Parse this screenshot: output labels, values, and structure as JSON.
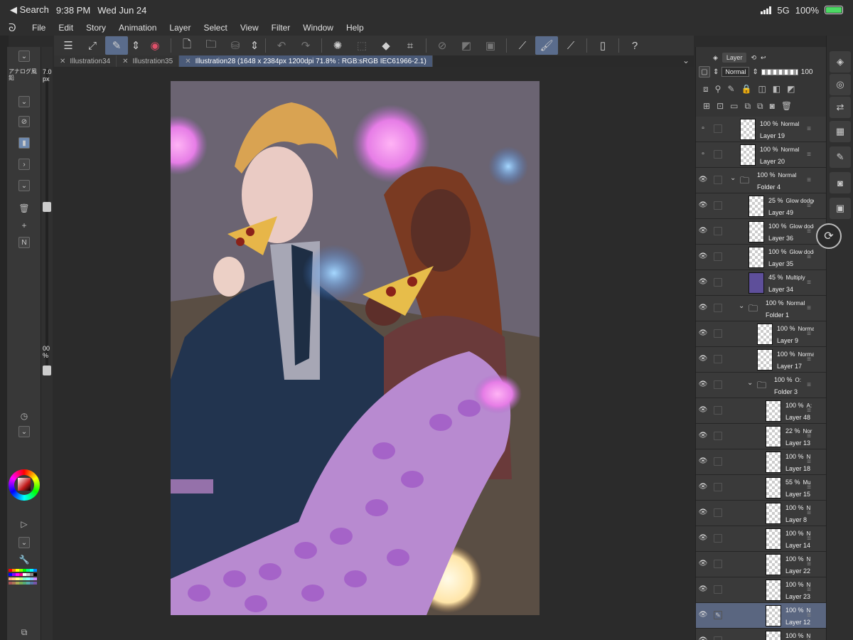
{
  "status_bar": {
    "back_label": "◀ Search",
    "time": "9:38 PM",
    "date": "Wed Jun 24",
    "network": "5G",
    "battery": "100%"
  },
  "menu": {
    "items": [
      "File",
      "Edit",
      "Story",
      "Animation",
      "Layer",
      "Select",
      "View",
      "Filter",
      "Window",
      "Help"
    ]
  },
  "tabs": [
    {
      "label": "Illustration34"
    },
    {
      "label": "Illustration35"
    },
    {
      "label": "Illustration28 (1648 x 2384px 1200dpi 71.8% : RGB:sRGB IEC61966-2.1)"
    }
  ],
  "left_panel": {
    "brush_name": "アナログ風鉛",
    "size_value": "7.0",
    "size_unit": "px",
    "opacity_value": "00",
    "opacity_unit": "%"
  },
  "layer_panel": {
    "tab_label": "Layer",
    "blend_mode": "Normal",
    "opacity": "100",
    "layers": [
      {
        "opacity": "100 %",
        "mode": "Normal",
        "name": "Layer 19",
        "visible": false,
        "indent": 0
      },
      {
        "opacity": "100 %",
        "mode": "Normal",
        "name": "Layer 20",
        "visible": false,
        "indent": 0
      },
      {
        "opacity": "100 %",
        "mode": "Normal",
        "name": "Folder 4",
        "visible": true,
        "indent": 0,
        "folder": true
      },
      {
        "opacity": "25 %",
        "mode": "Glow dodge",
        "name": "Layer 49",
        "visible": true,
        "indent": 1
      },
      {
        "opacity": "100 %",
        "mode": "Glow dodg",
        "name": "Layer 36",
        "visible": true,
        "indent": 1
      },
      {
        "opacity": "100 %",
        "mode": "Glow dodg",
        "name": "Layer 35",
        "visible": true,
        "indent": 1
      },
      {
        "opacity": "45 %",
        "mode": "Multiply",
        "name": "Layer 34",
        "visible": true,
        "indent": 1,
        "thumb": "purple"
      },
      {
        "opacity": "100 %",
        "mode": "Normal",
        "name": "Folder 1",
        "visible": true,
        "indent": 1,
        "folder": true
      },
      {
        "opacity": "100 %",
        "mode": "Norma",
        "name": "Layer 9",
        "visible": true,
        "indent": 2
      },
      {
        "opacity": "100 %",
        "mode": "Norma",
        "name": "Layer 17",
        "visible": true,
        "indent": 2
      },
      {
        "opacity": "100 %",
        "mode": "O:",
        "name": "Folder 3",
        "visible": true,
        "indent": 2,
        "folder": true
      },
      {
        "opacity": "100 %",
        "mode": "A:",
        "name": "Layer 48",
        "visible": true,
        "indent": 3
      },
      {
        "opacity": "22 %",
        "mode": "Nor",
        "name": "Layer 13",
        "visible": true,
        "indent": 3
      },
      {
        "opacity": "100 %",
        "mode": "N",
        "name": "Layer 18",
        "visible": true,
        "indent": 3
      },
      {
        "opacity": "55 %",
        "mode": "Mu",
        "name": "Layer 15",
        "visible": true,
        "indent": 3
      },
      {
        "opacity": "100 %",
        "mode": "N",
        "name": "Layer 8",
        "visible": true,
        "indent": 3
      },
      {
        "opacity": "100 %",
        "mode": "N",
        "name": "Layer 14",
        "visible": true,
        "indent": 3
      },
      {
        "opacity": "100 %",
        "mode": "N",
        "name": "Layer 22",
        "visible": true,
        "indent": 3
      },
      {
        "opacity": "100 %",
        "mode": "N",
        "name": "Layer 23",
        "visible": true,
        "indent": 3
      },
      {
        "opacity": "100 %",
        "mode": "N",
        "name": "Layer 12",
        "visible": true,
        "indent": 3,
        "selected": true
      },
      {
        "opacity": "100 %",
        "mode": "N",
        "name": "Layer 10",
        "visible": true,
        "indent": 3
      }
    ]
  },
  "colors": {
    "accent": "#5a6c8c",
    "selected_layer": "#5a6680",
    "battery_green": "#4cd964"
  }
}
